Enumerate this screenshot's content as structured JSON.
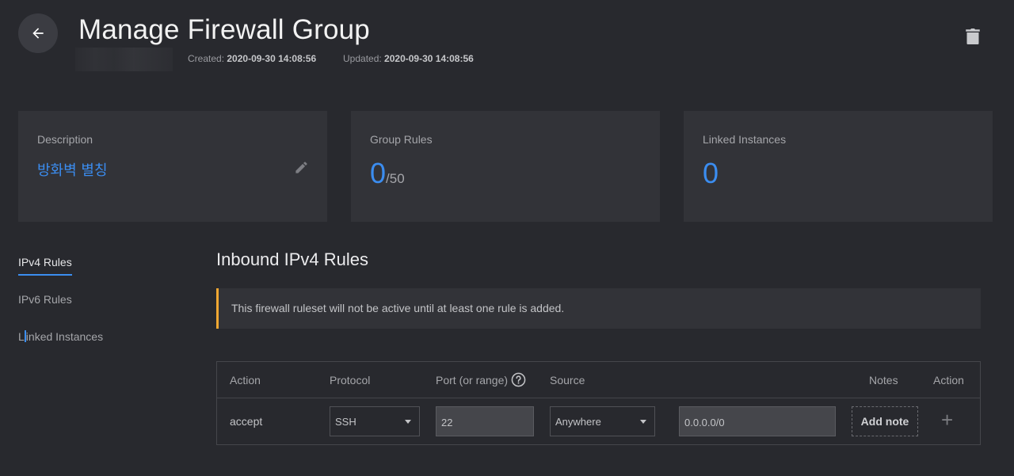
{
  "header": {
    "title": "Manage Firewall Group",
    "created_label": "Created:",
    "created_value": "2020-09-30 14:08:56",
    "updated_label": "Updated:",
    "updated_value": "2020-09-30 14:08:56",
    "back_icon": "arrow-left-icon",
    "delete_icon": "trash-icon"
  },
  "cards": {
    "description": {
      "label": "Description",
      "value": "방화벽 별칭"
    },
    "group_rules": {
      "label": "Group Rules",
      "value": "0",
      "max": "/50"
    },
    "linked_instances": {
      "label": "Linked Instances",
      "value": "0"
    }
  },
  "sidebar": {
    "tabs": [
      {
        "label": "IPv4 Rules",
        "active": true
      },
      {
        "label": "IPv6 Rules",
        "active": false
      },
      {
        "label_a": "L",
        "label_b": "inked Instances",
        "active": false
      }
    ]
  },
  "main": {
    "section_title": "Inbound IPv4 Rules",
    "notice": "This firewall ruleset will not be active until at least one rule is added.",
    "table": {
      "headers": {
        "action": "Action",
        "protocol": "Protocol",
        "port": "Port (or range)",
        "source": "Source",
        "notes": "Notes",
        "action_right": "Action"
      },
      "row": {
        "action": "accept",
        "protocol": "SSH",
        "port": "22",
        "source": "Anywhere",
        "cidr": "0.0.0.0/0",
        "add_note": "Add note",
        "add_symbol": "+"
      }
    }
  },
  "colors": {
    "background": "#28292e",
    "card": "#323338",
    "accent": "#3b8df0",
    "warning": "#f0a732"
  }
}
